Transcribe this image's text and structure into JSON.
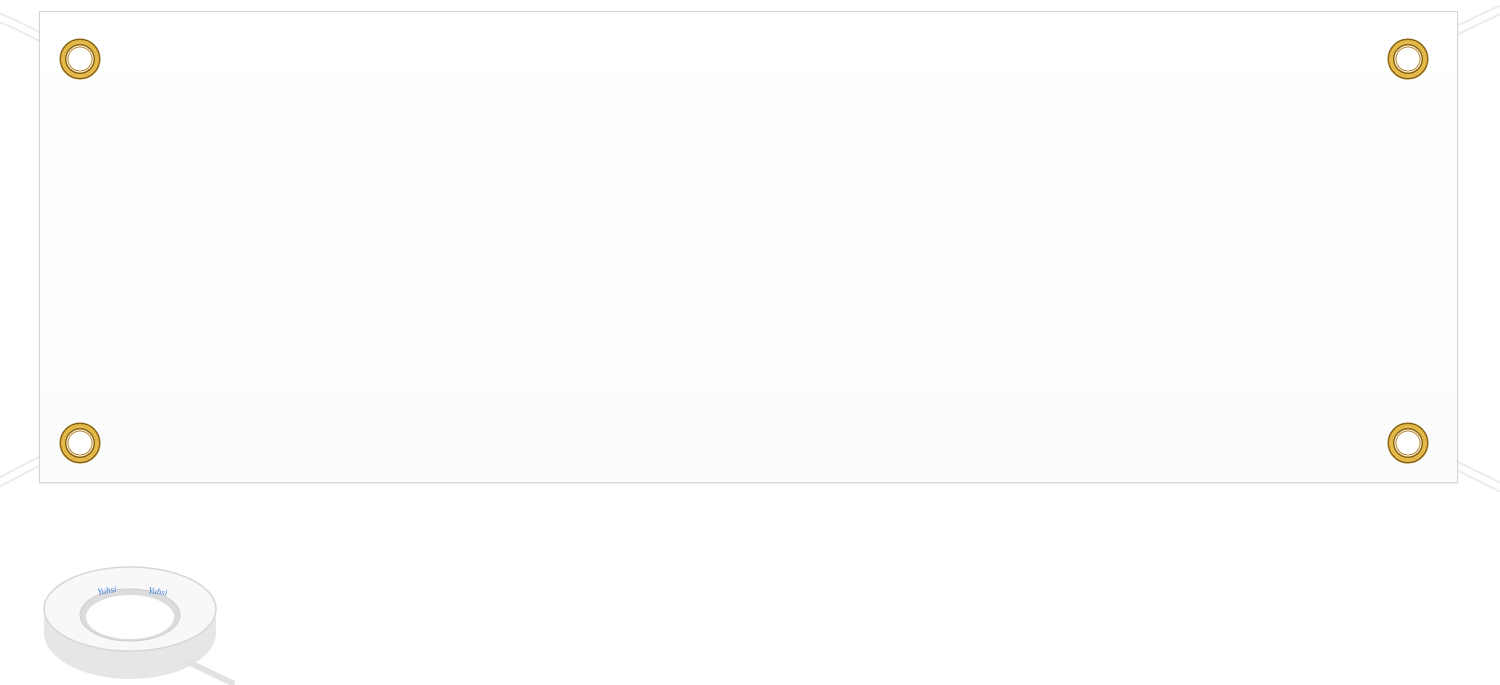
{
  "product": {
    "banner_color": "#ffffff",
    "grommet_color": "#d4a530",
    "rope_color": "#f2f2f2",
    "grommet_count": 4
  },
  "accessory": {
    "name": "tape-roll-icon",
    "brand_text": "Yuhsi"
  }
}
